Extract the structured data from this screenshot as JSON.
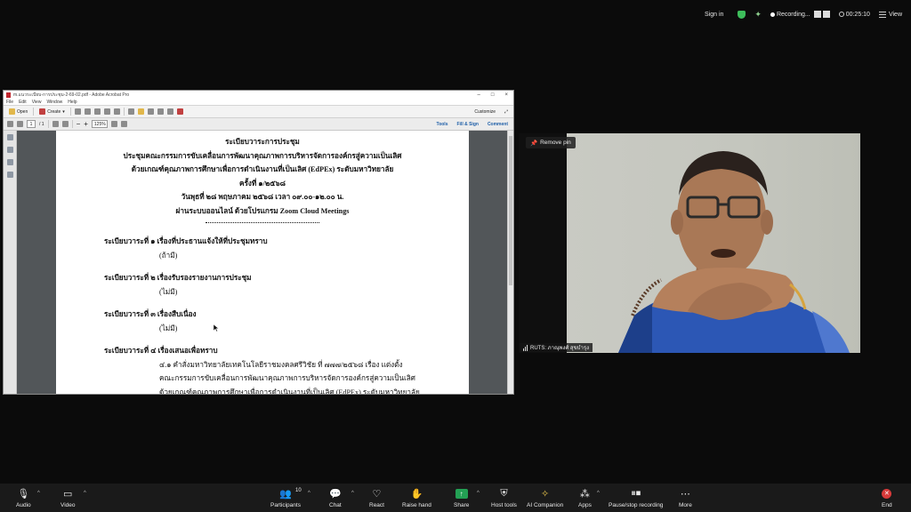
{
  "topbar": {
    "signin": "Sign in",
    "recording": "Recording...",
    "timer": "00:25:10",
    "view": "View"
  },
  "acrobat": {
    "title": "m.แนวระเบียบ-การประชุม-2-69-02.pdf - Adobe Acrobat Pro",
    "menu": [
      "File",
      "Edit",
      "View",
      "Window",
      "Help"
    ],
    "open_label": "Open",
    "create_label": "Create",
    "customize_label": "Customize",
    "page_current": "1",
    "page_total": "/ 1",
    "zoom": "125%",
    "tools_label": "Tools",
    "fillsign_label": "Fill & Sign",
    "comment_label": "Comment"
  },
  "document": {
    "header": [
      "ระเบียบวาระการประชุม",
      "ประชุมคณะกรรมการขับเคลื่อนการพัฒนาคุณภาพการบริหารจัดการองค์กรสู่ความเป็นเลิศ",
      "ด้วยเกณฑ์คุณภาพการศึกษาเพื่อการดำเนินงานที่เป็นเลิศ (EdPEx) ระดับมหาวิทยาลัย",
      "ครั้งที่  ๑/๒๕๖๘",
      "วันพุธที่ ๒๘ พฤษภาคม ๒๕๖๘ เวลา ๐๙.๐๐-๑๒.๐๐ น.",
      "ผ่านระบบออนไลน์ ด้วยโปรแกรม Zoom Cloud Meetings"
    ],
    "agenda": [
      {
        "title": "ระเบียบวาระที่ ๑  เรื่องที่ประธานแจ้งให้ที่ประชุมทราบ",
        "sub": "(ถ้ามี)"
      },
      {
        "title": "ระเบียบวาระที่ ๒  เรื่องรับรองรายงานการประชุม",
        "sub": "(ไม่มี)"
      },
      {
        "title": "ระเบียบวาระที่ ๓  เรื่องสืบเนื่อง",
        "sub": "(ไม่มี)"
      },
      {
        "title": "ระเบียบวาระที่ ๔  เรื่องเสนอเพื่อทราบ",
        "sub": ""
      }
    ],
    "item_4_lines": [
      "๔.๑ คำสั่งมหาวิทยาลัยเทคโนโลยีราชมงคลศรีวิชัย ที่ ๗๗๗/๒๕๖๘ เรื่อง แต่งตั้ง",
      "คณะกรรมการขับเคลื่อนการพัฒนาคุณภาพการบริหารจัดการองค์กรสู่ความเป็นเลิศ",
      "ด้วยเกณฑ์คุณภาพการศึกษาเพื่อการดำเนินงานที่เป็นเลิศ (EdPEx) ระดับมหาวิทยาลัย"
    ]
  },
  "video": {
    "pin_label": "Remove pin",
    "participant_name": "RUTS: ภาณุพงศ์ สุขบำรุง"
  },
  "toolbar": {
    "audio": "Audio",
    "video": "Video",
    "participants": "Participants",
    "participants_count": "10",
    "chat": "Chat",
    "react": "React",
    "raise_hand": "Raise hand",
    "share": "Share",
    "host_tools": "Host tools",
    "ai_companion": "AI Companion",
    "apps": "Apps",
    "pause_recording": "Pause/stop recording",
    "more": "More",
    "end": "End"
  }
}
